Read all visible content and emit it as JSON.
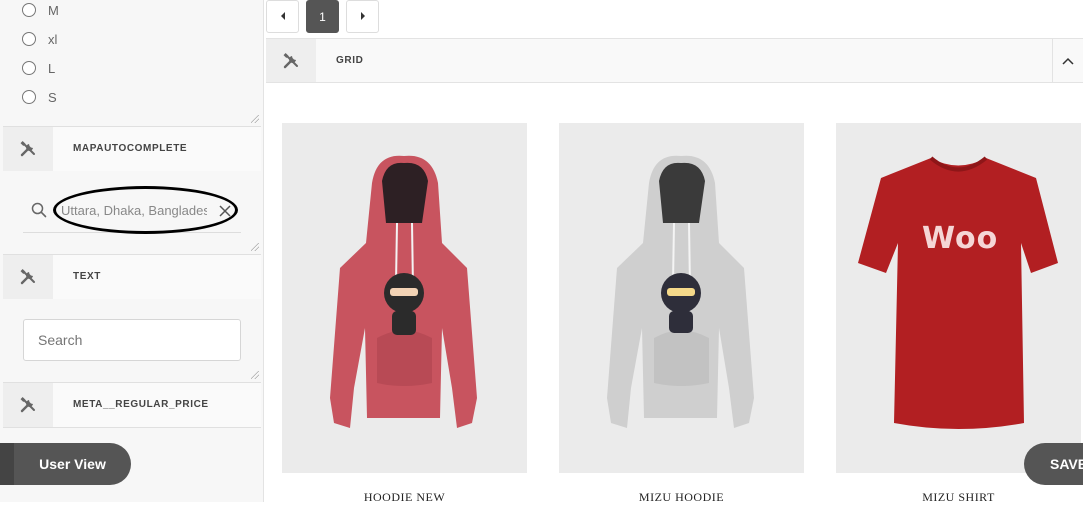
{
  "sidebar": {
    "size_options": [
      "M",
      "xl",
      "L",
      "S"
    ],
    "sections": [
      {
        "title": "MAPAUTOCOMPLETE",
        "icon": "tools-icon"
      },
      {
        "title": "TEXT",
        "icon": "tools-icon"
      },
      {
        "title": "META__REGULAR_PRICE",
        "icon": "tools-icon"
      }
    ],
    "map_input_value": "Uttara, Dhaka, Banglades",
    "text_search_placeholder": "Search",
    "user_view_label": "User View"
  },
  "pagination": {
    "current_page": "1"
  },
  "grid": {
    "title": "GRID",
    "products": [
      {
        "name": "HOODIE NEW",
        "color": "#c8545f"
      },
      {
        "name": "MIZU HOODIE",
        "color": "#cfcfcf"
      },
      {
        "name": "MIZU SHIRT",
        "color": "#b21f22",
        "logo": "Woo"
      }
    ]
  },
  "save_label": "SAVE",
  "colors": {
    "accent_dark": "#555555",
    "highlight": "#000000"
  }
}
